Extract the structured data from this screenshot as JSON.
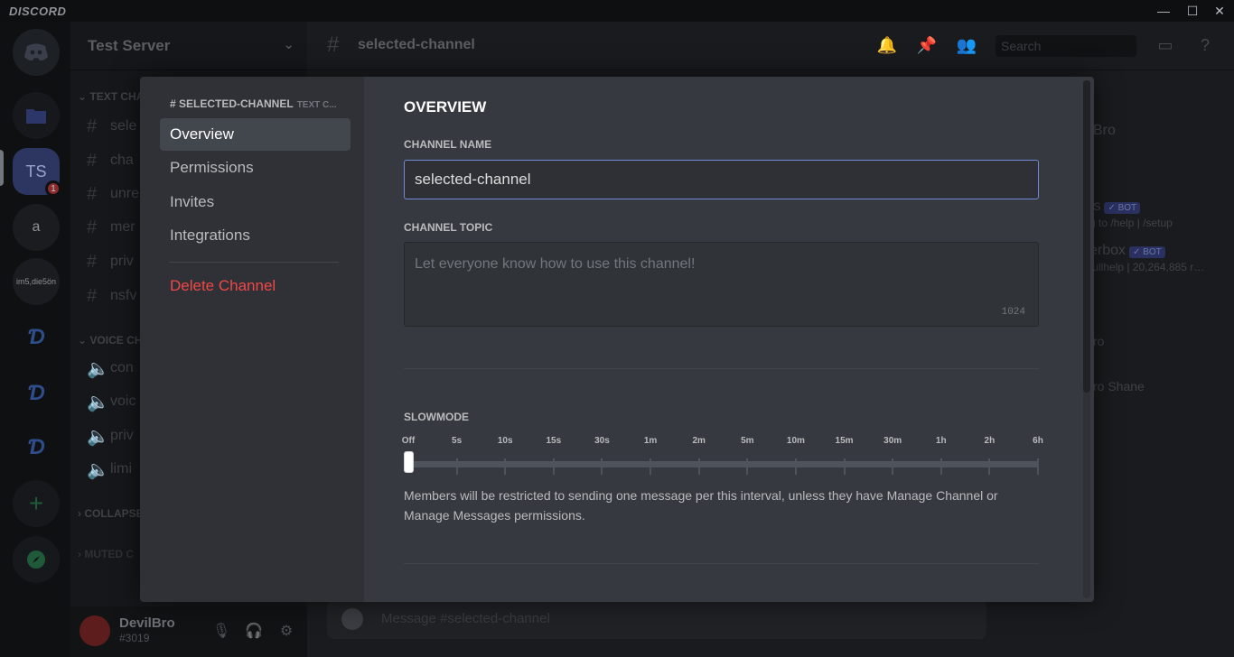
{
  "titlebar": {
    "brand": "DISCORD",
    "minimize": "—",
    "maximize": "☐",
    "close": "✕"
  },
  "servers": {
    "home": "discord-logo",
    "active": "TS",
    "active_badge": "1",
    "other1": "a",
    "other2": "im5,die5ön"
  },
  "sidebar": {
    "server_name": "Test Server",
    "categories": [
      "TEXT CHA",
      "VOICE CH",
      "COLLAPSE",
      "MUTED C"
    ],
    "text_channels": [
      "sele",
      "cha",
      "unre",
      "mer",
      "priv",
      "nsfv"
    ],
    "voice_channels": [
      "con",
      "voic",
      "priv",
      "limi"
    ],
    "user": {
      "name": "DevilBro",
      "tag": "#3019"
    }
  },
  "main": {
    "channel_title": "selected-channel",
    "search_placeholder": "Search",
    "message_placeholder": "Message #selected-channel",
    "members": [
      "Bro",
      "ts",
      "g to /help | /setup",
      "erbox",
      "tullhelp | 20,264,885 r…",
      "ro",
      "ro Shane"
    ],
    "bot_label": "✓ BOT"
  },
  "modal": {
    "breadcrumb": "# SELECTED-CHANNEL",
    "breadcrumb_sub": "TEXT C...",
    "nav": [
      "Overview",
      "Permissions",
      "Invites",
      "Integrations"
    ],
    "delete_label": "Delete Channel",
    "heading": "OVERVIEW",
    "channel_name_label": "CHANNEL NAME",
    "channel_name_value": "selected-channel",
    "channel_topic_label": "CHANNEL TOPIC",
    "channel_topic_placeholder": "Let everyone know how to use this channel!",
    "topic_char_count": "1024",
    "slowmode_label": "SLOWMODE",
    "slowmode_ticks": [
      "Off",
      "5s",
      "10s",
      "15s",
      "30s",
      "1m",
      "2m",
      "5m",
      "10m",
      "15m",
      "30m",
      "1h",
      "2h",
      "6h"
    ],
    "slowmode_selected": "Off",
    "slowmode_help": "Members will be restricted to sending one message per this interval, unless they have Manage Channel or Manage Messages permissions."
  }
}
